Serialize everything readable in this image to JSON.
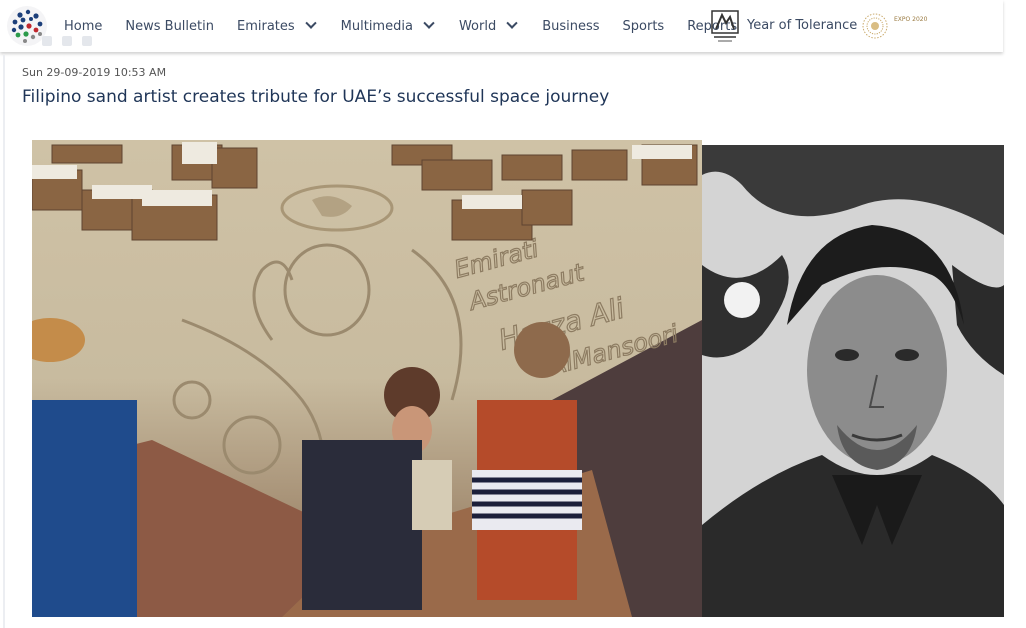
{
  "nav": {
    "items": [
      {
        "label": "Home",
        "has_dropdown": false
      },
      {
        "label": "News Bulletin",
        "has_dropdown": false
      },
      {
        "label": "Emirates",
        "has_dropdown": true
      },
      {
        "label": "Multimedia",
        "has_dropdown": true
      },
      {
        "label": "World",
        "has_dropdown": true
      },
      {
        "label": "Business",
        "has_dropdown": false
      },
      {
        "label": "Sports",
        "has_dropdown": false
      },
      {
        "label": "Reports",
        "has_dropdown": false
      }
    ],
    "year_of_tolerance_label": "Year of Tolerance",
    "expo_logo_text": "EXPO 2020"
  },
  "article": {
    "date": "Sun 29-09-2019 10:53 AM",
    "title": "Filipino sand artist creates tribute for UAE’s successful space journey"
  },
  "images": {
    "sand_art_text": [
      "Emirati",
      "Astronaut",
      "Hazza Ali",
      "AlMansoori"
    ]
  },
  "colors": {
    "nav_text": "#3b4a63",
    "title": "#1f3557"
  }
}
